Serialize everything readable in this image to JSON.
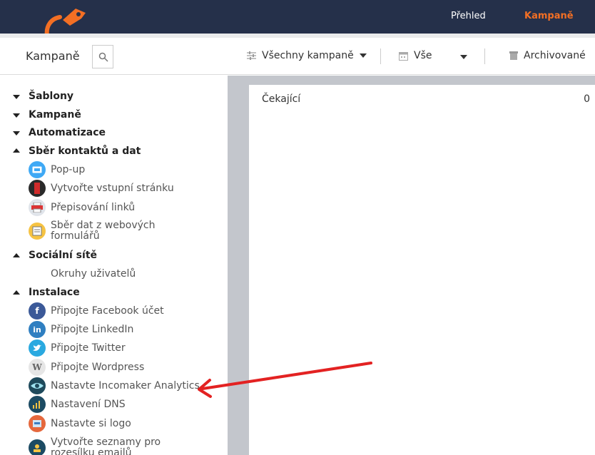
{
  "topnav": {
    "items": [
      "Přehled",
      "Kampaně"
    ],
    "active": "Kampaně",
    "colors": {
      "bar": "#25304a",
      "accent": "#f36f24"
    }
  },
  "header": {
    "title": "Kampaně",
    "filters": {
      "campaigns": "Všechny kampaně",
      "all": "Vše",
      "archived": "Archivované"
    }
  },
  "sidebar": {
    "sections": [
      {
        "label": "Šablony",
        "expanded": false
      },
      {
        "label": "Kampaně",
        "expanded": false
      },
      {
        "label": "Automatizace",
        "expanded": false
      },
      {
        "label": "Sběr kontaktů a dat",
        "expanded": true,
        "items": [
          {
            "label": "Pop-up",
            "icon": "popup-icon"
          },
          {
            "label": "Vytvořte vstupní stránku",
            "icon": "landing-page-icon"
          },
          {
            "label": "Přepisování linků",
            "icon": "printer-icon"
          },
          {
            "label": "Sběr dat z webových formulářů",
            "icon": "form-icon"
          }
        ]
      },
      {
        "label": "Sociální sítě",
        "expanded": true,
        "items": [
          {
            "label": "Okruhy uživatelů"
          }
        ]
      },
      {
        "label": "Instalace",
        "expanded": true,
        "items": [
          {
            "label": "Připojte Facebook účet",
            "icon": "facebook-icon"
          },
          {
            "label": "Připojte LinkedIn",
            "icon": "linkedin-icon"
          },
          {
            "label": "Připojte Twitter",
            "icon": "twitter-icon"
          },
          {
            "label": "Připojte Wordpress",
            "icon": "wordpress-icon"
          },
          {
            "label": "Nastavte Incomaker Analytics",
            "icon": "analytics-eye-icon"
          },
          {
            "label": "Nastavení DNS",
            "icon": "dns-icon"
          },
          {
            "label": "Nastavte si logo",
            "icon": "logo-icon"
          },
          {
            "label": "Vytvořte seznamy pro rozesílku emailů",
            "icon": "mailing-list-icon"
          }
        ]
      }
    ]
  },
  "main": {
    "card": {
      "label": "Čekající",
      "count": "0"
    }
  }
}
